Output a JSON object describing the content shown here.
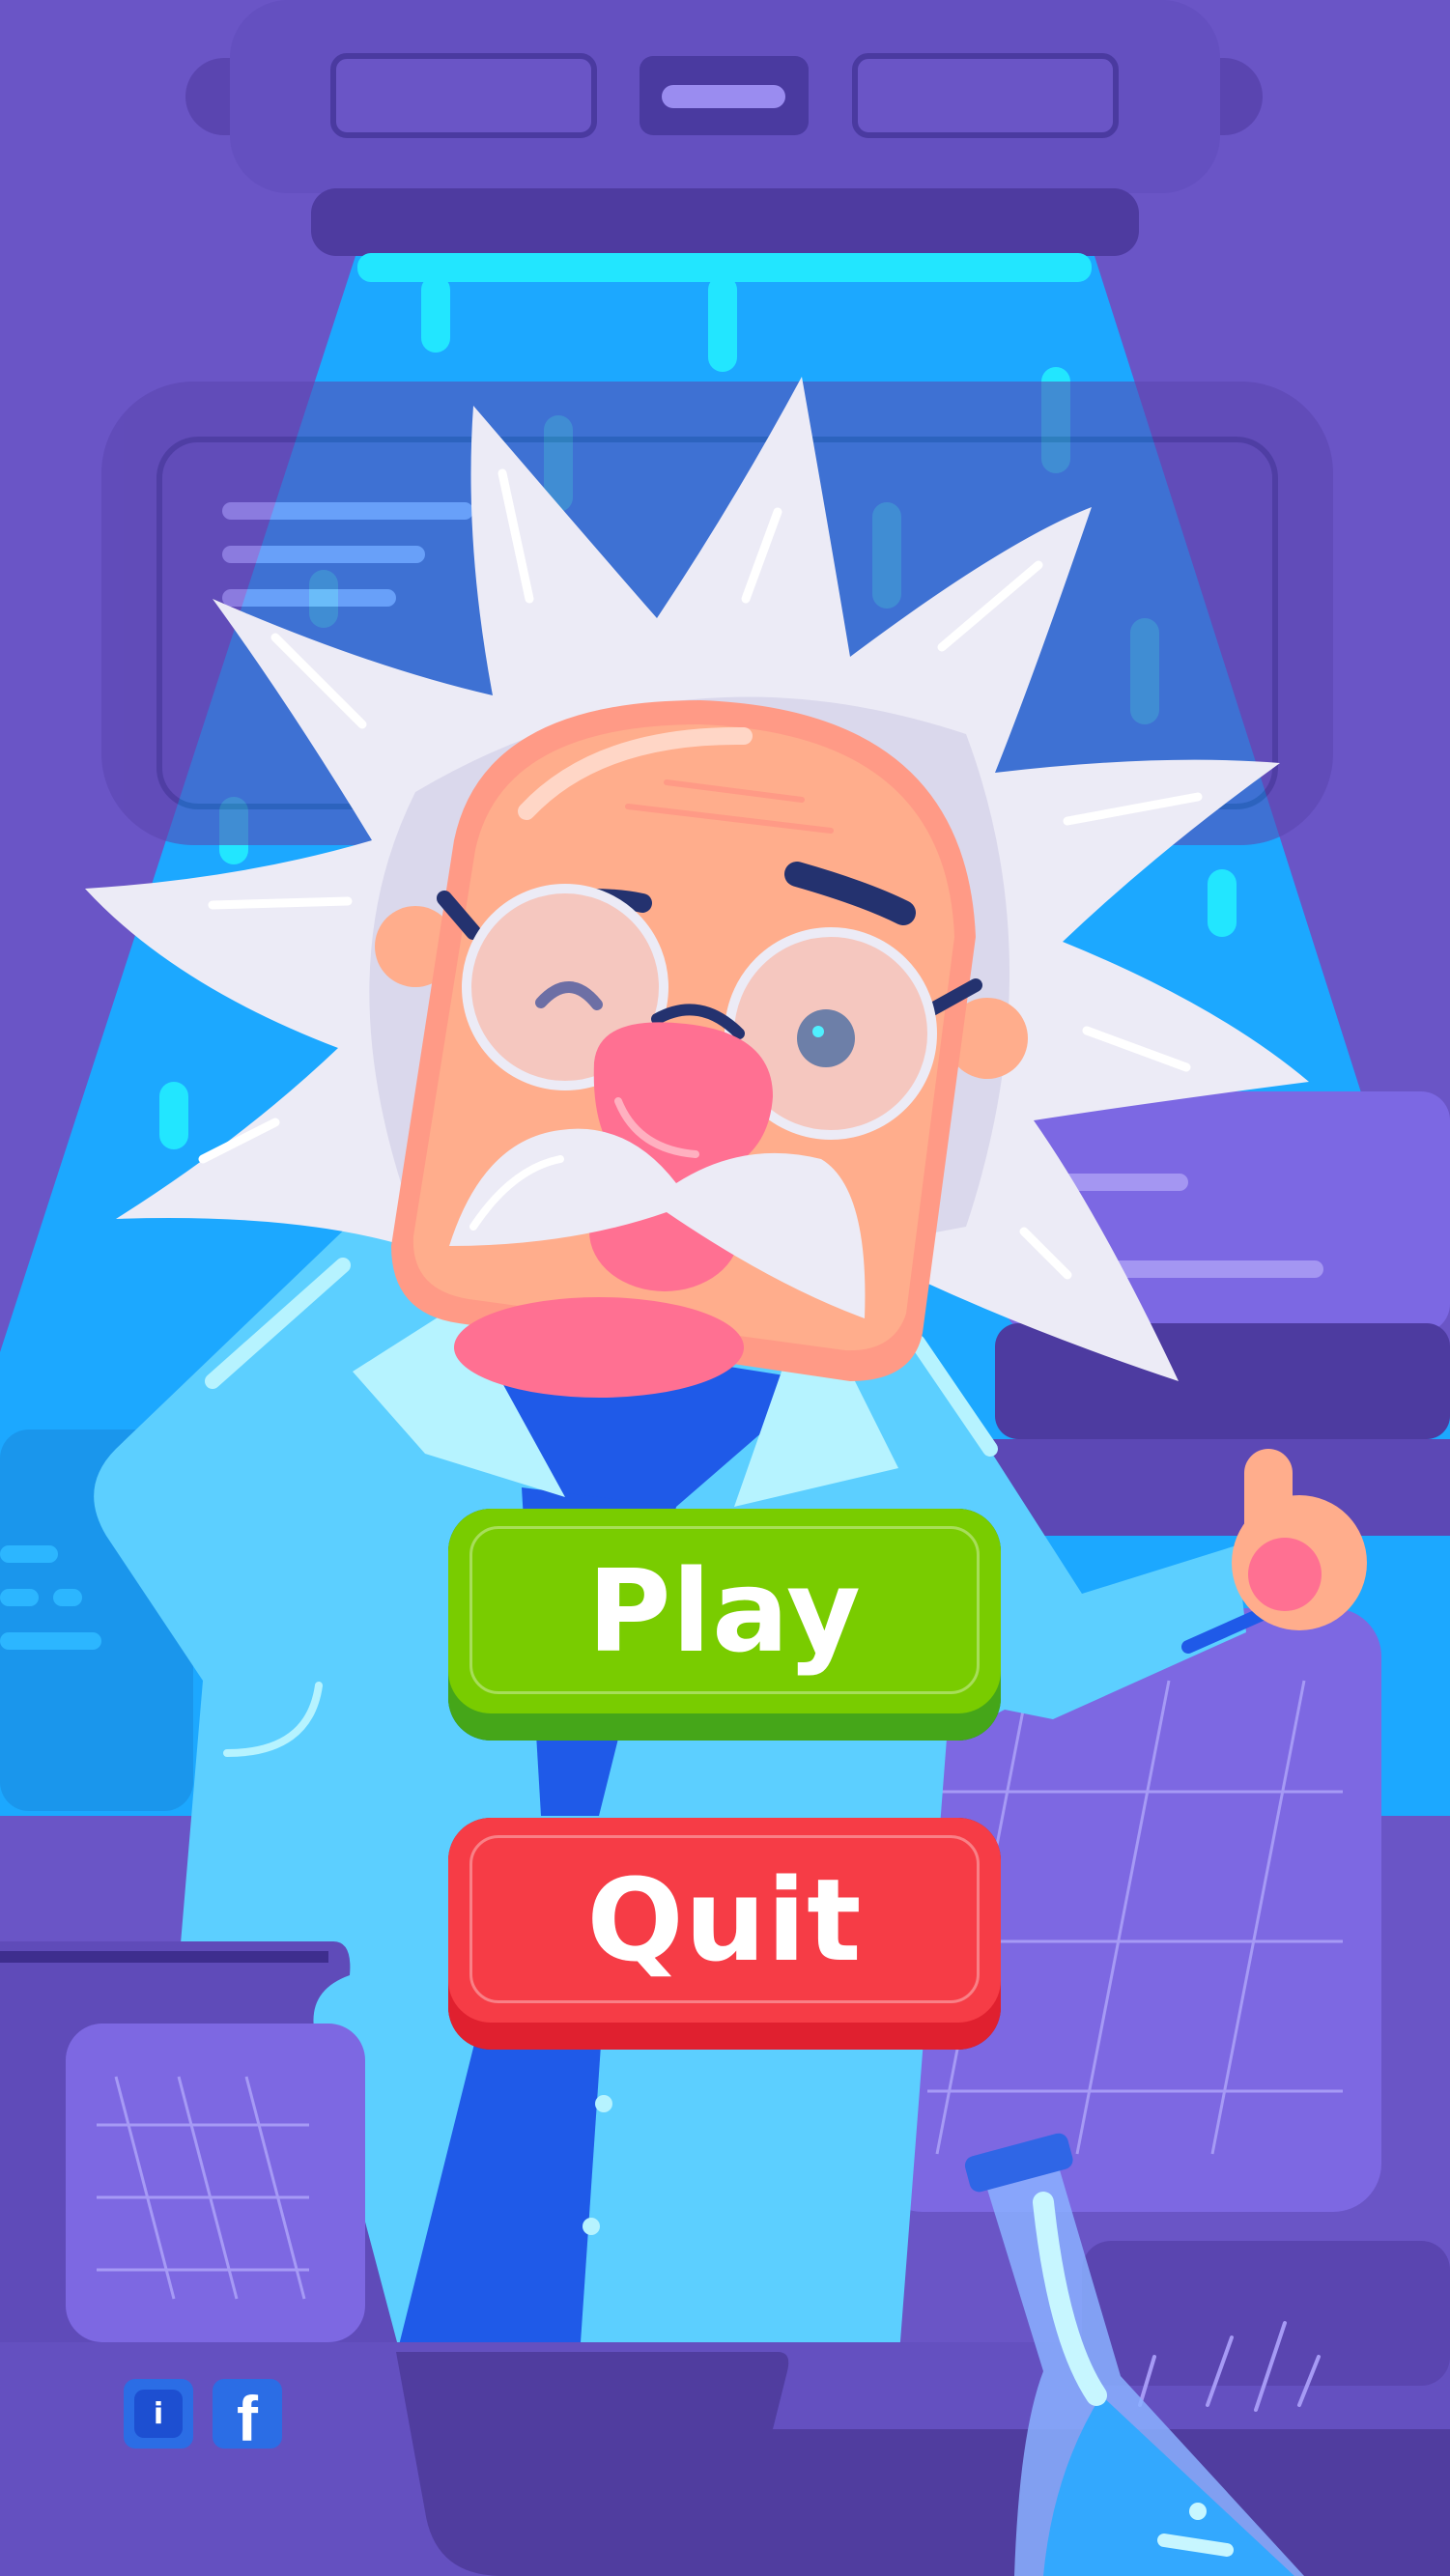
{
  "menu": {
    "play_label": "Play",
    "quit_label": "Quit"
  },
  "footer": {
    "info_icon_glyph": "i",
    "facebook_icon_glyph": "f"
  },
  "colors": {
    "background": "#6a55c6",
    "beam": "#1ca8ff",
    "play_button": "#79cc00",
    "quit_button": "#f63c46",
    "lab_coat": "#5ccfff",
    "skin": "#ffad8c",
    "hair": "#ecebf6",
    "social_button": "#2b6de5"
  },
  "icons": [
    "info-icon",
    "facebook-icon"
  ]
}
